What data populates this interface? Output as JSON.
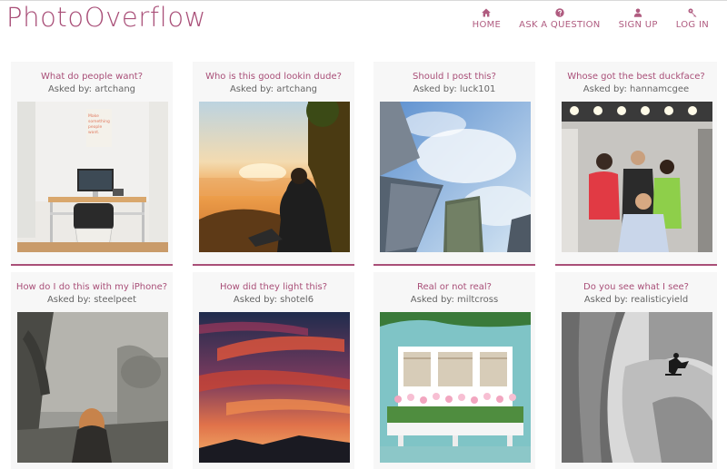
{
  "brand": {
    "logo": "PhotoOverflow"
  },
  "nav": [
    {
      "label": "HOME",
      "icon": "home-icon"
    },
    {
      "label": "ASK A QUESTION",
      "icon": "question-icon"
    },
    {
      "label": "SIGN UP",
      "icon": "user-icon"
    },
    {
      "label": "LOG IN",
      "icon": "key-icon"
    }
  ],
  "cards": [
    {
      "title": "What do people want?",
      "asked_by": "Asked by: artchang",
      "image": "desk-workspace-photo"
    },
    {
      "title": "Who is this good lookin dude?",
      "asked_by": "Asked by: artchang",
      "image": "sunset-hiker-photo"
    },
    {
      "title": "Should I post this?",
      "asked_by": "Asked by: luck101",
      "image": "skyscrapers-photo"
    },
    {
      "title": "Whose got the best duckface?",
      "asked_by": "Asked by: hannamcgee",
      "image": "group-selfie-photo"
    },
    {
      "title": "How do I do this with my iPhone?",
      "asked_by": "Asked by: steelpeet",
      "image": "foggy-forest-photo"
    },
    {
      "title": "How did they light this?",
      "asked_by": "Asked by: shotel6",
      "image": "sunset-sky-photo"
    },
    {
      "title": "Real or not real?",
      "asked_by": "Asked by: miltcross",
      "image": "window-flowers-photo"
    },
    {
      "title": "Do you see what I see?",
      "asked_by": "Asked by: realisticyield",
      "image": "skateboarder-photo"
    }
  ],
  "colors": {
    "accent": "#a94f78",
    "card_bg": "#f7f7f7"
  }
}
